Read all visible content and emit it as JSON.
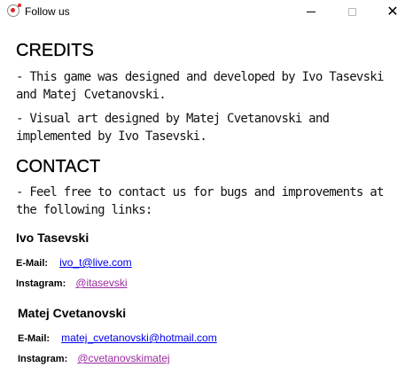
{
  "window": {
    "title": "Follow us",
    "minimize_icon": "minimize-icon",
    "maximize_icon": "maximize-icon",
    "close_icon": "close-icon",
    "close_glyph": "✕"
  },
  "credits": {
    "heading": "CREDITS",
    "lines": [
      "- This game was designed and developed by Ivo Tasevski and Matej Cvetanovski.",
      "- Visual art designed by Matej Cvetanovski and implemented by Ivo Tasevski."
    ]
  },
  "contact": {
    "heading": "CONTACT",
    "intro": "- Feel free to contact us for bugs and improvements at the following links:",
    "people": [
      {
        "name": "Ivo Tasevski",
        "email_label": "E-Mail:",
        "email": "ivo_t@live.com",
        "instagram_label": "Instagram:",
        "instagram": "@itasevski"
      },
      {
        "name": "Matej Cvetanovski",
        "email_label": "E-Mail:",
        "email": "matej_cvetanovski@hotmail.com",
        "instagram_label": "Instagram:",
        "instagram": "@cvetanovskimatej"
      }
    ]
  },
  "colors": {
    "link_unvisited": "#0000ee",
    "link_visited": "#9a2ba0",
    "app_icon_accent": "#e0242a"
  }
}
